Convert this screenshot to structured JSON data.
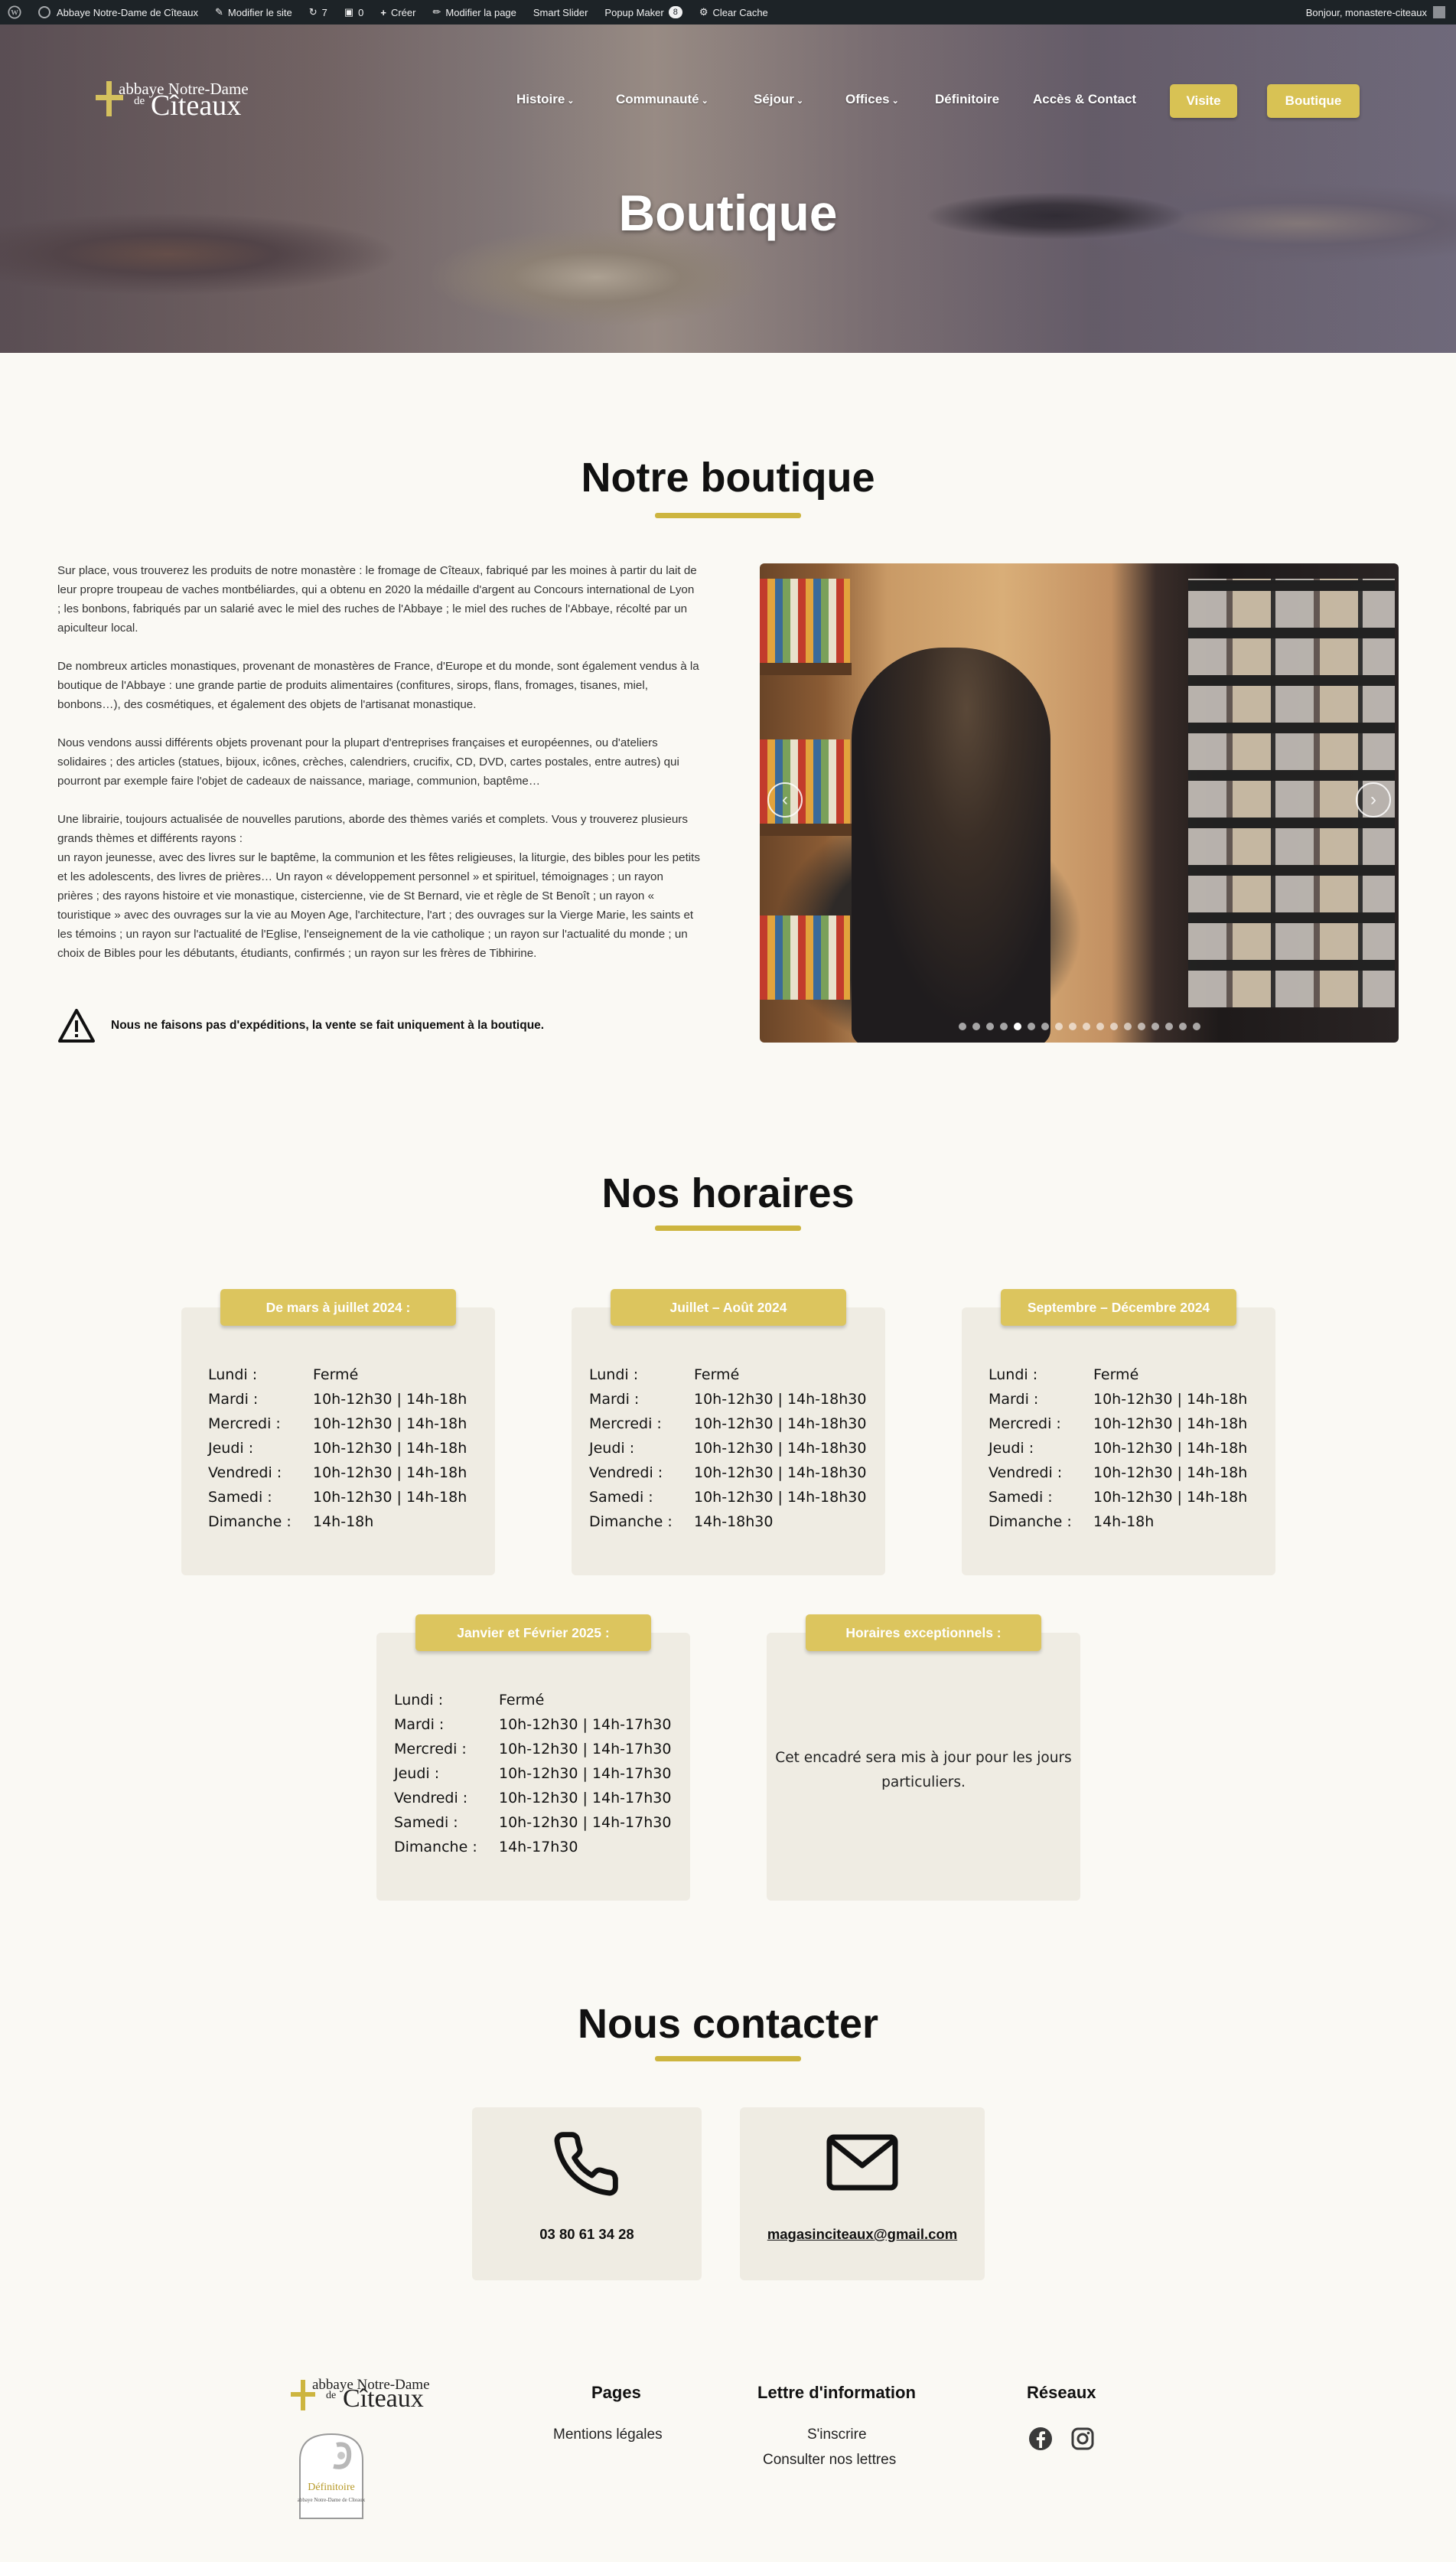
{
  "adminbar": {
    "site_name": "Abbaye Notre-Dame de Cîteaux",
    "edit_site": "Modifier le site",
    "updates_count": "7",
    "comments_count": "0",
    "create": "Créer",
    "edit_page": "Modifier la page",
    "smart_slider": "Smart Slider",
    "popup_maker": "Popup Maker",
    "popup_count": "8",
    "clear_cache": "Clear Cache",
    "greeting": "Bonjour, monastere-citeaux"
  },
  "brand": {
    "line1": "abbaye Notre-Dame",
    "line2": "de",
    "line3": "Cîteaux",
    "accent_color": "#d8c254"
  },
  "nav": {
    "items": [
      "Histoire",
      "Communauté",
      "Séjour",
      "Offices",
      "Définitoire",
      "Accès & Contact"
    ],
    "buttons": [
      "Visite",
      "Boutique"
    ]
  },
  "hero": {
    "title": "Boutique"
  },
  "boutique": {
    "title": "Notre boutique",
    "paragraphs": [
      "Sur place, vous trouverez les produits de notre monastère : le fromage de Cîteaux, fabriqué par les moines à partir du lait de leur propre troupeau de vaches montbéliardes, qui a obtenu en 2020 la médaille d'argent au Concours international de Lyon ; les bonbons, fabriqués par un salarié avec le miel des ruches de l'Abbaye ; le miel des ruches de l'Abbaye, récolté par un apiculteur local.",
      "De nombreux articles monastiques, provenant de monastères de France, d'Europe et du monde, sont également vendus à la boutique de l'Abbaye : une grande partie de produits alimentaires (confitures, sirops, flans, fromages, tisanes, miel, bonbons…), des cosmétiques, et également des objets de l'artisanat monastique.",
      "Nous vendons aussi différents objets provenant pour la plupart d'entreprises françaises et européennes, ou d'ateliers solidaires ; des articles (statues, bijoux, icônes, crèches, calendriers, crucifix, CD, DVD, cartes postales, entre autres) qui pourront par exemple faire l'objet de cadeaux de naissance, mariage, communion, baptême…",
      "Une librairie, toujours actualisée de nouvelles parutions, aborde des thèmes variés et complets. Vous y trouverez plusieurs grands thèmes et différents rayons :\nun rayon jeunesse, avec des livres sur le baptême, la communion et les fêtes religieuses, la liturgie, des bibles pour les petits et les adolescents, des livres de prières… Un rayon « développement personnel » et spirituel, témoignages ; un rayon prières ; des rayons histoire et vie monastique, cistercienne, vie de St Bernard, vie et règle de St Benoît ; un rayon « touristique » avec des ouvrages sur la vie au Moyen Age, l'architecture, l'art ; des ouvrages sur la Vierge Marie, les saints et les témoins ; un rayon sur l'actualité de l'Eglise, l'enseignement de la vie catholique ; un rayon sur l'actualité du monde ; un choix de Bibles pour les débutants, étudiants, confirmés ; un rayon sur les frères de Tibhirine."
    ],
    "notice": "Nous ne faisons pas d'expéditions, la vente se fait uniquement à la boutique.",
    "slider": {
      "slide_count": 18,
      "active_index": 4
    }
  },
  "horaires": {
    "title": "Nos horaires",
    "cards": [
      {
        "title": "De mars à  juillet 2024 :",
        "rows": [
          {
            "day": "Lundi :",
            "hours": "Fermé"
          },
          {
            "day": "Mardi :",
            "hours": "10h-12h30 | 14h-18h"
          },
          {
            "day": "Mercredi :",
            "hours": "10h-12h30 | 14h-18h"
          },
          {
            "day": "Jeudi :",
            "hours": "10h-12h30 | 14h-18h"
          },
          {
            "day": "Vendredi :",
            "hours": "10h-12h30 | 14h-18h"
          },
          {
            "day": "Samedi :",
            "hours": "10h-12h30 | 14h-18h"
          },
          {
            "day": "Dimanche :",
            "hours": "14h-18h"
          }
        ]
      },
      {
        "title": "Juillet – Août 2024",
        "rows": [
          {
            "day": "Lundi :",
            "hours": "Fermé"
          },
          {
            "day": "Mardi :",
            "hours": "10h-12h30 | 14h-18h30"
          },
          {
            "day": "Mercredi :",
            "hours": "10h-12h30 | 14h-18h30"
          },
          {
            "day": "Jeudi :",
            "hours": "10h-12h30 | 14h-18h30"
          },
          {
            "day": "Vendredi :",
            "hours": "10h-12h30 | 14h-18h30"
          },
          {
            "day": "Samedi :",
            "hours": "10h-12h30 | 14h-18h30"
          },
          {
            "day": "Dimanche :",
            "hours": "14h-18h30"
          }
        ]
      },
      {
        "title": "Septembre – Décembre 2024",
        "rows": [
          {
            "day": "Lundi :",
            "hours": "Fermé"
          },
          {
            "day": "Mardi :",
            "hours": "10h-12h30 | 14h-18h"
          },
          {
            "day": "Mercredi :",
            "hours": "10h-12h30 | 14h-18h"
          },
          {
            "day": "Jeudi :",
            "hours": "10h-12h30 | 14h-18h"
          },
          {
            "day": "Vendredi :",
            "hours": "10h-12h30 | 14h-18h"
          },
          {
            "day": "Samedi :",
            "hours": "10h-12h30 | 14h-18h"
          },
          {
            "day": "Dimanche :",
            "hours": "14h-18h"
          }
        ]
      },
      {
        "title": "Janvier et Février 2025 :",
        "rows": [
          {
            "day": "Lundi :",
            "hours": "Fermé"
          },
          {
            "day": "Mardi :",
            "hours": "10h-12h30 | 14h-17h30"
          },
          {
            "day": "Mercredi :",
            "hours": "10h-12h30 | 14h-17h30"
          },
          {
            "day": "Jeudi :",
            "hours": "10h-12h30 | 14h-17h30"
          },
          {
            "day": "Vendredi :",
            "hours": "10h-12h30 | 14h-17h30"
          },
          {
            "day": "Samedi :",
            "hours": "10h-12h30 | 14h-17h30"
          },
          {
            "day": "Dimanche :",
            "hours": "14h-17h30"
          }
        ]
      }
    ],
    "exceptional": {
      "title": "Horaires exceptionnels :",
      "text": "Cet encadré sera mis à jour pour les jours particuliers."
    }
  },
  "contact": {
    "title": "Nous contacter",
    "phone": "03 80 61 34 28",
    "email": "magasinciteaux@gmail.com"
  },
  "footer": {
    "badge_label": "Définitoire",
    "badge_sub": "abbaye Notre-Dame de Cîteaux",
    "pages_title": "Pages",
    "pages_links": [
      "Mentions légales"
    ],
    "newsletter_title": "Lettre d'information",
    "newsletter_links": [
      "S'inscrire",
      "Consulter nos lettres"
    ],
    "social_title": "Réseaux",
    "social_icons": [
      "facebook-icon",
      "instagram-icon"
    ]
  }
}
